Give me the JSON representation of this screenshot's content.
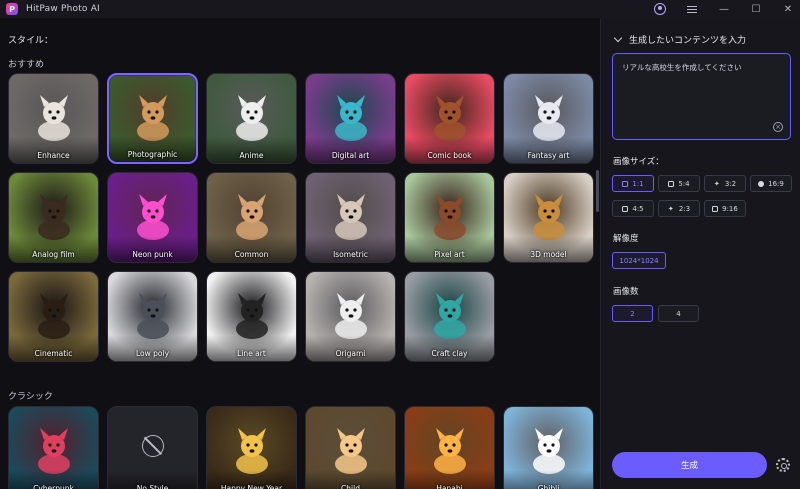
{
  "app": {
    "title": "HitPaw Photo AI"
  },
  "left": {
    "style_label": "スタイル：",
    "recommended_label": "おすすめ",
    "classic_label": "クラシック",
    "recommended": [
      {
        "label": "Enhance",
        "bg": "#6d6a66",
        "fg": "#e9e4dc"
      },
      {
        "label": "Photographic",
        "bg": "#3c5a2c",
        "fg": "#d49a5c",
        "selected": true
      },
      {
        "label": "Anime",
        "bg": "#3f5a3d",
        "fg": "#eeeeee"
      },
      {
        "label": "Digital art",
        "bg": "#7a3d8c",
        "fg": "#3ab7c8"
      },
      {
        "label": "Comic book",
        "bg": "#e94b62",
        "fg": "#a0522d"
      },
      {
        "label": "Fantasy art",
        "bg": "#7d8aa5",
        "fg": "#e8eaf0"
      },
      {
        "label": "Analog film",
        "bg": "#6d8a3a",
        "fg": "#3b2a1e"
      },
      {
        "label": "Neon punk",
        "bg": "#6a1f8a",
        "fg": "#ff4fd0"
      },
      {
        "label": "Common",
        "bg": "#6e6148",
        "fg": "#d8a472"
      },
      {
        "label": "Isometric",
        "bg": "#6e6272",
        "fg": "#d7c7b8"
      },
      {
        "label": "Pixel art",
        "bg": "#a8c79b",
        "fg": "#8b4a2a"
      },
      {
        "label": "3D model",
        "bg": "#d8d0c6",
        "fg": "#c98e3c"
      },
      {
        "label": "Cinematic",
        "bg": "#7c6a3c",
        "fg": "#2a1e14"
      },
      {
        "label": "Low poly",
        "bg": "#d9d9dc",
        "fg": "#4a4f58"
      },
      {
        "label": "Line art",
        "bg": "#f1f1f1",
        "fg": "#222222"
      },
      {
        "label": "Origami",
        "bg": "#b7b3b0",
        "fg": "#eeeeee"
      },
      {
        "label": "Craft clay",
        "bg": "#9a9ea4",
        "fg": "#2fa8a4"
      }
    ],
    "classic": [
      {
        "label": "Cyberpunk",
        "bg": "#1b4a5a",
        "fg": "#e04060"
      },
      {
        "label": "No Style",
        "bg": "#24242b",
        "fg": "#b8b8c4",
        "nostyle": true
      },
      {
        "label": "Happy New Year",
        "bg": "#3a2a18",
        "fg": "#f2c24a"
      },
      {
        "label": "Child",
        "bg": "#5c4a2e",
        "fg": "#f4c988"
      },
      {
        "label": "Hanabi",
        "bg": "#8a3d15",
        "fg": "#ffb347"
      },
      {
        "label": "Ghibli",
        "bg": "#7fb3d9",
        "fg": "#ffffff"
      }
    ]
  },
  "right": {
    "header": "生成したいコンテンツを入力",
    "prompt": "リアルな高校生を作成してください",
    "size_label": "画像サイズ：",
    "sizes": [
      {
        "label": "1:1",
        "icon": "instagram-icon",
        "active": true
      },
      {
        "label": "5:4",
        "icon": "instagram-icon",
        "active": false
      },
      {
        "label": "3:2",
        "icon": "twitter-icon",
        "active": false
      },
      {
        "label": "16:9",
        "icon": "facebook-icon",
        "active": false
      },
      {
        "label": "4:5",
        "icon": "instagram-icon",
        "active": false
      },
      {
        "label": "2:3",
        "icon": "twitter-icon",
        "active": false
      },
      {
        "label": "9:16",
        "icon": "tiktok-icon",
        "active": false
      }
    ],
    "resolution_label": "解像度",
    "resolution": "1024*1024",
    "count_label": "画像数",
    "counts": [
      {
        "label": "2",
        "active": true
      },
      {
        "label": "4",
        "active": false
      }
    ],
    "generate_label": "生成"
  },
  "colors": {
    "accent": "#6b5cff",
    "panel_bg": "#16161c",
    "app_bg": "#0f0f14"
  }
}
